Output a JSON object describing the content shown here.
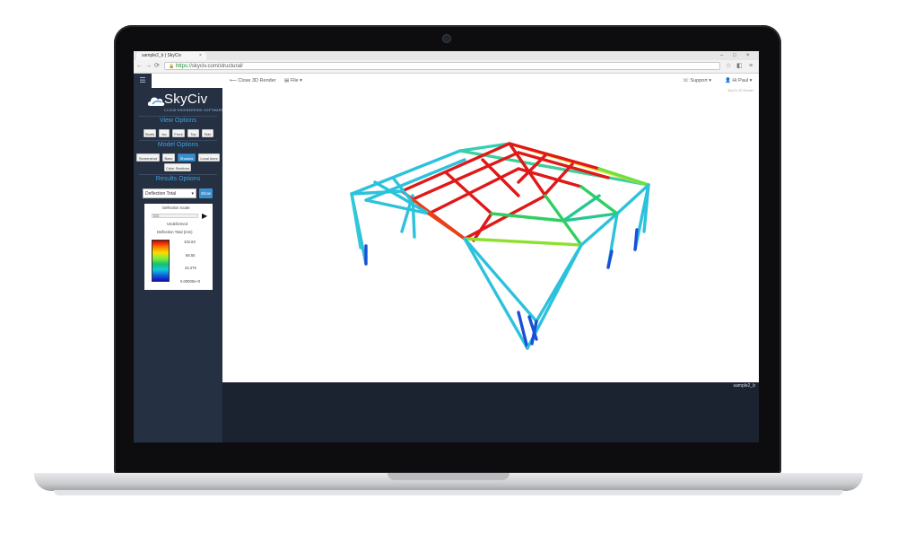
{
  "browser": {
    "tab_title": "sample2_b | SkyCiv",
    "tab_close": "×",
    "url_secure": "https://",
    "url_rest": "skyciv.com/structural/",
    "window_controls": [
      "–",
      "□",
      "×"
    ]
  },
  "appbar": {
    "menu_icon": "hamburger-icon",
    "close_render": "⟵ Close 3D Render",
    "file_menu": "File ▾",
    "support": "Support ▾",
    "user": "Hi Paul ▾"
  },
  "sidebar": {
    "logo_text": "SkyCiv",
    "logo_sub": "CLOUD ENGINEERING SOFTWARE",
    "view_options_title": "View Options",
    "view_buttons": [
      "Starts",
      "Iso",
      "Front",
      "Top",
      "Side"
    ],
    "model_options_title": "Model Options",
    "model_buttons": [
      "Screenshot",
      "Base",
      "Shadow",
      "Local Axes",
      "Color Sections"
    ],
    "results_options_title": "Results Options",
    "results_select": "Deflection Total",
    "show_button": "Show",
    "deflection_scale_label": "Deflection Scale:",
    "undeformed_label": "Undeformed",
    "legend_title": "Deflection Total (mm)",
    "legend_values": [
      "102.83",
      "68.55",
      "34.275",
      "0.00000e+0"
    ]
  },
  "main": {
    "corner_text": "SkyCiv 3D Render",
    "footer_name": "sample2_b"
  },
  "colors": {
    "sidebar_bg": "#253042",
    "accent": "#3fa3e0",
    "button_active": "#3a8fcf"
  }
}
